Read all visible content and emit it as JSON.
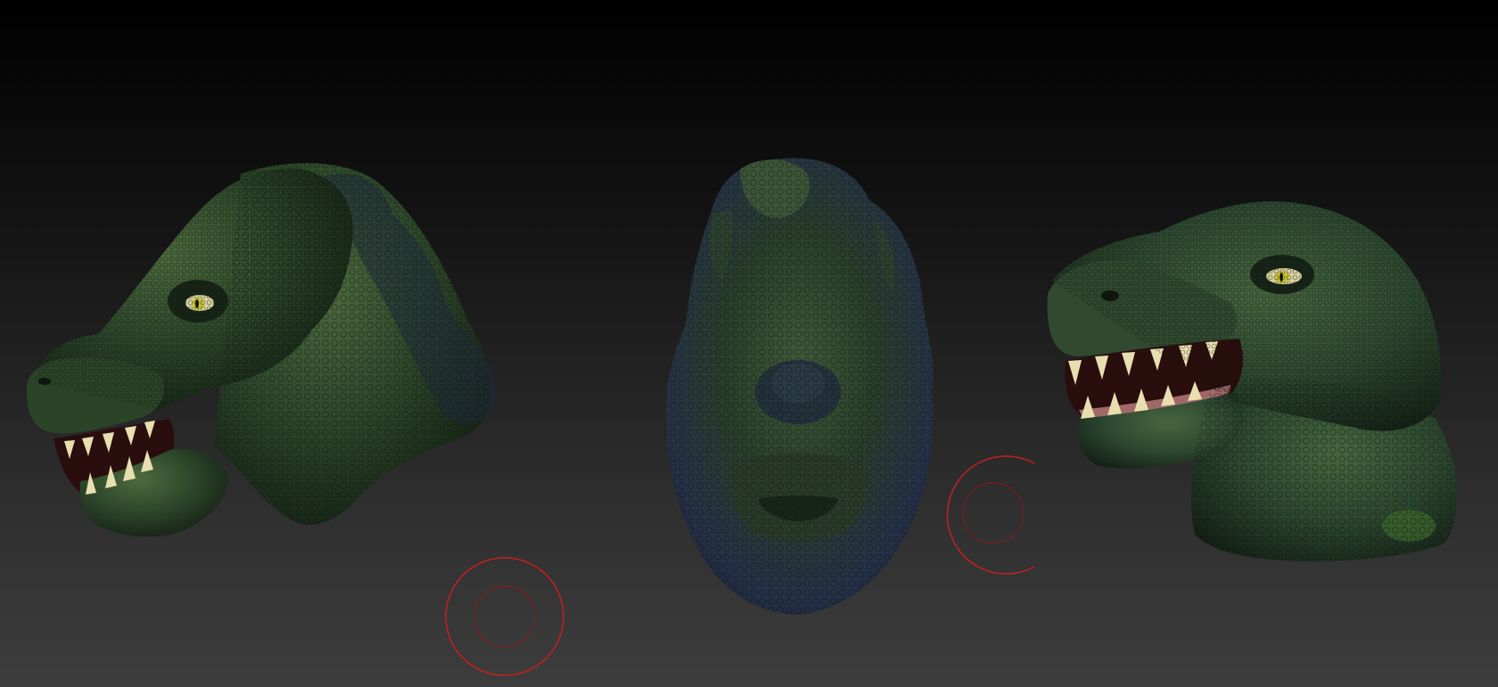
{
  "viewport": {
    "background_top": "#000000",
    "background_bottom": "#3d3d3d"
  },
  "colors": {
    "skin_dark": "#1a2a1a",
    "skin_mid": "#2f4a2c",
    "skin_light": "#4d6a3e",
    "skin_blue": "#2a3550",
    "mouth": "#2a0d0d",
    "gum": "#b57a7a",
    "teeth": "#e8dfb0",
    "eye_iris": "#c9c032",
    "brush_cursor": "#c42020"
  },
  "models": [
    {
      "view": "three-quarter-left"
    },
    {
      "view": "front"
    },
    {
      "view": "three-quarter-right"
    }
  ],
  "brush_cursors": [
    {
      "state": "active"
    },
    {
      "state": "active"
    }
  ]
}
